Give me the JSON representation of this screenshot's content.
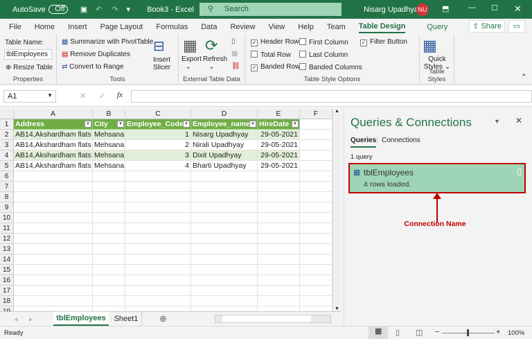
{
  "titlebar": {
    "autosave": "AutoSave",
    "toggle": "Off",
    "doc": "Book3 - Excel",
    "search": "Search",
    "user": "Nisarg Upadhyay",
    "initials": "NU"
  },
  "menu": {
    "tabs": [
      "File",
      "Home",
      "Insert",
      "Page Layout",
      "Formulas",
      "Data",
      "Review",
      "View",
      "Help",
      "Team"
    ],
    "active": "Table Design",
    "extra": "Query",
    "share": "Share"
  },
  "ribbon": {
    "properties": {
      "label": "Properties",
      "table_name_label": "Table Name:",
      "table_name": "tblEmployees",
      "resize": "Resize Table"
    },
    "tools": {
      "label": "Tools",
      "summarize": "Summarize with PivotTable",
      "remove_dup": "Remove Duplicates",
      "convert": "Convert to Range",
      "insert_slicer_1": "Insert",
      "insert_slicer_2": "Slicer"
    },
    "external": {
      "label": "External Table Data",
      "export": "Export",
      "refresh": "Refresh"
    },
    "style_options": {
      "label": "Table Style Options",
      "options": [
        {
          "label": "Header Row",
          "checked": true
        },
        {
          "label": "Total Row",
          "checked": false
        },
        {
          "label": "Banded Rows",
          "checked": true
        },
        {
          "label": "First Column",
          "checked": false
        },
        {
          "label": "Last Column",
          "checked": false
        },
        {
          "label": "Banded Columns",
          "checked": false
        },
        {
          "label": "Filter Button",
          "checked": true
        }
      ]
    },
    "styles": {
      "label": "Table Styles",
      "quick_1": "Quick",
      "quick_2": "Styles"
    }
  },
  "formula_bar": {
    "name_box": "A1",
    "value": ""
  },
  "sheet": {
    "columns": [
      "A",
      "B",
      "C",
      "D",
      "E",
      "F"
    ],
    "header": [
      "Address",
      "City",
      "Employee_Code",
      "Employee_name",
      "HireDate"
    ],
    "rows": [
      [
        "AB14,Akshardham flats",
        "Mehsana",
        "1",
        "Nisarg Upadhyay",
        "29-05-2021"
      ],
      [
        "AB14,Akshardham flats",
        "Mehsana",
        "2",
        "Nirali Upadhyay",
        "29-05-2021"
      ],
      [
        "AB14,Akshardham flats",
        "Mehsana",
        "3",
        "Dixit Upadhyay",
        "29-05-2021"
      ],
      [
        "AB14,Akshardham flats",
        "Mehsana",
        "4",
        "Bharti Upadhyay",
        "29-05-2021"
      ]
    ],
    "row_numbers": [
      "1",
      "2",
      "3",
      "4",
      "5",
      "6",
      "7",
      "8",
      "9",
      "10",
      "11",
      "12",
      "13",
      "14",
      "15",
      "16",
      "17",
      "18",
      "19"
    ],
    "tabs": [
      "tblEmployees",
      "Sheet1"
    ],
    "active_tab": "tblEmployees"
  },
  "pane": {
    "title": "Queries & Connections",
    "tabs": [
      "Queries",
      "Connections"
    ],
    "count": "1 query",
    "query_name": "tblEmployees",
    "query_status": "4 rows loaded.",
    "annotation": "Connection Name"
  },
  "status": {
    "text": "Ready",
    "zoom": "100%"
  },
  "colors": {
    "excel_green": "#217346",
    "table_header": "#70ad47",
    "band": "#e2efda",
    "query_bg": "#9fd5b7",
    "annotation_red": "#c00000"
  }
}
